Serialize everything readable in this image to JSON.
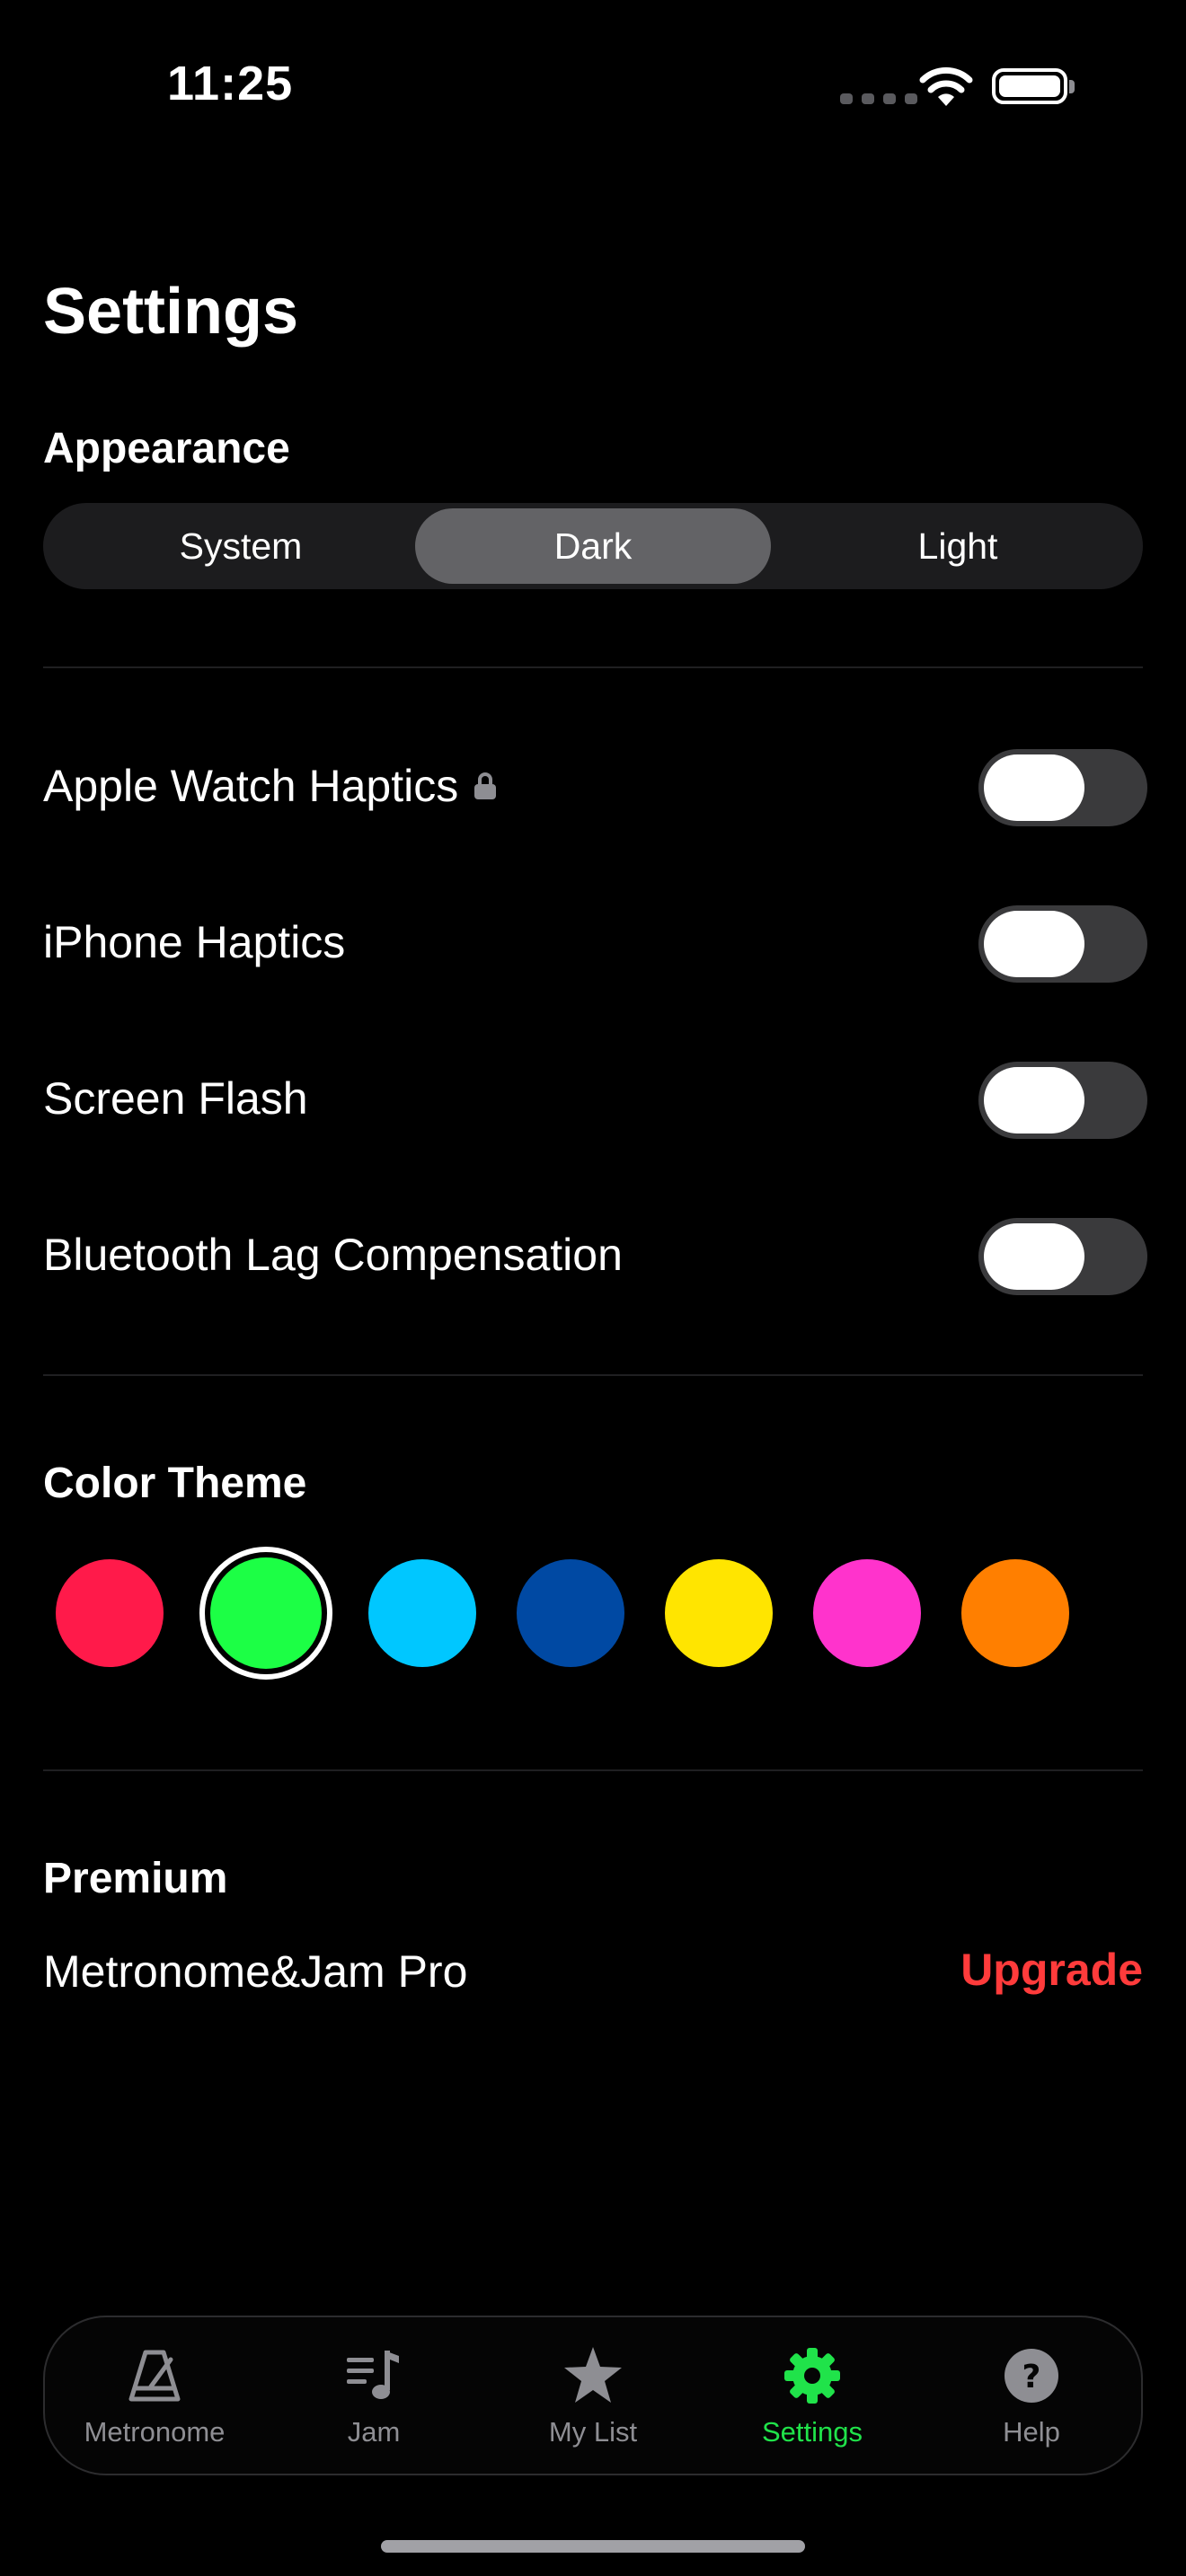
{
  "status_bar": {
    "time": "11:25"
  },
  "page_title": "Settings",
  "appearance": {
    "title": "Appearance",
    "options": [
      "System",
      "Dark",
      "Light"
    ],
    "selected": "Dark"
  },
  "toggles": [
    {
      "label": "Apple Watch Haptics",
      "locked": true,
      "on": false
    },
    {
      "label": "iPhone Haptics",
      "locked": false,
      "on": false
    },
    {
      "label": "Screen Flash",
      "locked": false,
      "on": false
    },
    {
      "label": "Bluetooth Lag Compensation",
      "locked": false,
      "on": false
    }
  ],
  "color_theme": {
    "title": "Color Theme",
    "colors": [
      "#ff1a4a",
      "#1cff45",
      "#00c7ff",
      "#0049a3",
      "#ffe500",
      "#ff33cc",
      "#ff7f00"
    ],
    "selected_index": 1
  },
  "premium": {
    "title": "Premium",
    "product": "Metronome&Jam Pro",
    "action": "Upgrade",
    "action_color": "#ff3b3b"
  },
  "tab_bar": {
    "tabs": [
      {
        "label": "Metronome",
        "icon": "metronome-icon"
      },
      {
        "label": "Jam",
        "icon": "music-list-icon"
      },
      {
        "label": "My List",
        "icon": "star-icon"
      },
      {
        "label": "Settings",
        "icon": "gear-icon"
      },
      {
        "label": "Help",
        "icon": "help-icon"
      }
    ],
    "active": "Settings",
    "active_color": "#20e34a"
  }
}
